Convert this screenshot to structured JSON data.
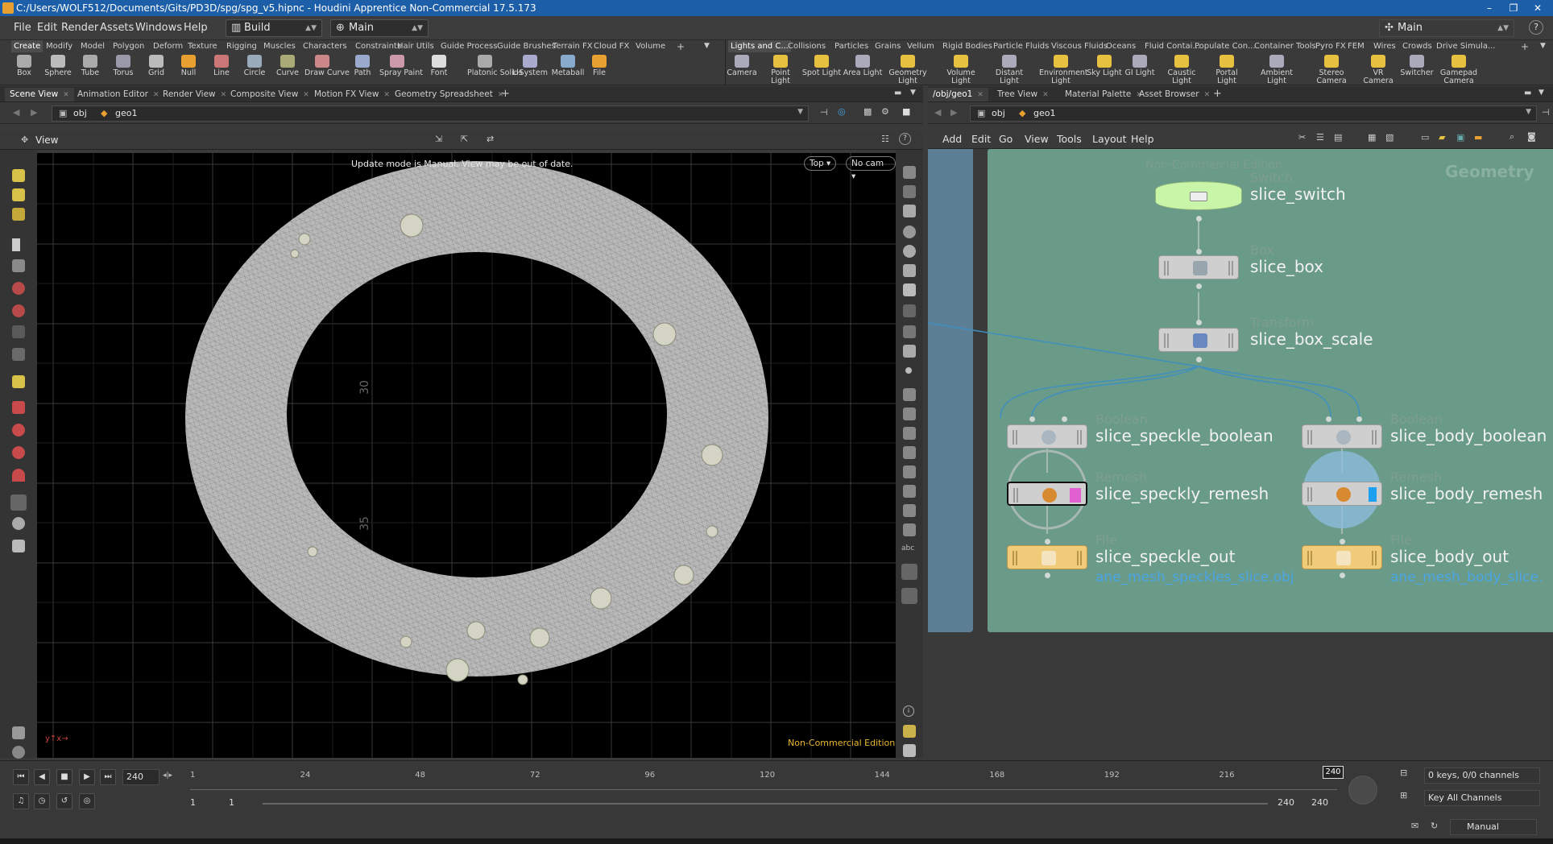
{
  "window": {
    "title": "C:/Users/WOLF512/Documents/Gits/PD3D/spg/spg_v5.hipnc - Houdini Apprentice Non-Commercial 17.5.173",
    "controls": [
      "–",
      "❐",
      "✕"
    ]
  },
  "menu": {
    "items": [
      "File",
      "Edit",
      "Render",
      "Assets",
      "Windows",
      "Help"
    ],
    "desktop": "Build",
    "context": "Main",
    "workspace": "Main",
    "help_icon": "?"
  },
  "shelf_left": {
    "tabs": [
      "Create",
      "Modify",
      "Model",
      "Polygon",
      "Deform",
      "Texture",
      "Rigging",
      "Muscles",
      "Characters",
      "Constraints",
      "Hair Utils",
      "Guide Process",
      "Guide Brushes",
      "Terrain FX",
      "Cloud FX",
      "Volume"
    ],
    "tools": [
      "Box",
      "Sphere",
      "Tube",
      "Torus",
      "Grid",
      "Null",
      "Line",
      "Circle",
      "Curve",
      "Draw Curve",
      "Path",
      "Spray Paint",
      "Font",
      "Platonic Solids",
      "L-System",
      "Metaball",
      "File"
    ]
  },
  "shelf_right": {
    "tabs": [
      "Lights and C...",
      "Collisions",
      "Particles",
      "Grains",
      "Vellum",
      "Rigid Bodies",
      "Particle Fluids",
      "Viscous Fluids",
      "Oceans",
      "Fluid Contai...",
      "Populate Con...",
      "Container Tools",
      "Pyro FX",
      "FEM",
      "Wires",
      "Crowds",
      "Drive Simula..."
    ],
    "tools": [
      "Camera",
      "Point Light",
      "Spot Light",
      "Area Light",
      "Geometry Light",
      "Volume Light",
      "Distant Light",
      "Environment Light",
      "Sky Light",
      "GI Light",
      "Caustic Light",
      "Portal Light",
      "Ambient Light",
      "Stereo Camera",
      "VR Camera",
      "Switcher",
      "Gamepad Camera"
    ]
  },
  "left_panes": {
    "tabs": [
      "Scene View",
      "Animation Editor",
      "Render View",
      "Composite View",
      "Motion FX View",
      "Geometry Spreadsheet"
    ],
    "path": [
      "obj",
      "geo1"
    ]
  },
  "viewport": {
    "label": "View",
    "message": "Update mode is Manual. View may be out of date.",
    "view_menu": "Top",
    "camera_menu": "No cam",
    "watermark": "Non-Commercial Edition",
    "grid_labels": [
      "30",
      "35"
    ]
  },
  "right_panes": {
    "tabs": [
      "/obj/geo1",
      "Tree View",
      "Material Palette",
      "Asset Browser"
    ],
    "path": [
      "obj",
      "geo1"
    ],
    "menu": [
      "Add",
      "Edit",
      "Go",
      "View",
      "Tools",
      "Layout",
      "Help"
    ]
  },
  "network": {
    "context_label": "Geometry",
    "faded_label": "Non-Commercial Edition",
    "nodes": [
      {
        "type": "Switch",
        "name": "slice_switch"
      },
      {
        "type": "Box",
        "name": "slice_box"
      },
      {
        "type": "Transform",
        "name": "slice_box_scale"
      },
      {
        "type": "Boolean",
        "name": "slice_speckle_boolean"
      },
      {
        "type": "Boolean",
        "name": "slice_body_boolean"
      },
      {
        "type": "Remesh",
        "name": "slice_speckly_remesh"
      },
      {
        "type": "Remesh",
        "name": "slice_body_remesh"
      },
      {
        "type": "File",
        "name": "slice_speckle_out",
        "file": "ane_mesh_speckles_slice.obj"
      },
      {
        "type": "File",
        "name": "slice_body_out",
        "file": "ane_mesh_body_slice."
      }
    ]
  },
  "timeline": {
    "current_frame": "240",
    "ticks": [
      "1",
      "24",
      "48",
      "72",
      "96",
      "120",
      "144",
      "168",
      "192",
      "216"
    ],
    "end_marker": "240",
    "range_start": "1",
    "range_start2": "1",
    "range_end": "240",
    "range_end2": "240",
    "keys_info": "0 keys, 0/0 channels",
    "key_channels": "Key All Channels",
    "update_mode": "Manual"
  },
  "colors": {
    "network_bg": "#6a9a88",
    "switch_node": "#c9f5a8",
    "file_node": "#f0cc7a",
    "link_color": "#4aa6e6",
    "title_bar": "#1c5fa8"
  }
}
